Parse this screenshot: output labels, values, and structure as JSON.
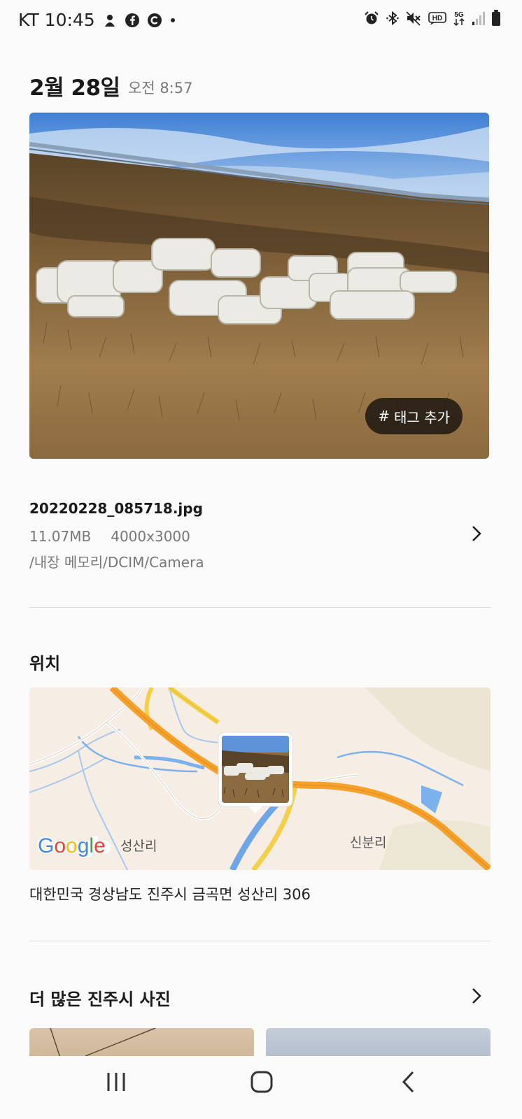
{
  "status_bar": {
    "carrier_time": "KT 10:45",
    "notification_icons": [
      "game-launcher-icon",
      "facebook-icon",
      "c-app-icon",
      "dot-icon"
    ],
    "system_icons": [
      "alarm-icon",
      "bluetooth-icon",
      "mute-icon",
      "hd-voice-icon",
      "5g-icon",
      "signal-icon",
      "battery-icon"
    ],
    "hd_label": "HD",
    "net_label": "5G"
  },
  "header": {
    "date": "2월 28일",
    "time": "오전 8:57"
  },
  "photo": {
    "tag_button_label": "태그 추가",
    "tag_symbol": "#"
  },
  "file_info": {
    "name": "20220228_085718.jpg",
    "size": "11.07MB",
    "resolution": "4000x3000",
    "path": "/내장 메모리/DCIM/Camera"
  },
  "location": {
    "title": "위치",
    "map_labels": {
      "village_left": "성산리",
      "village_right": "신분리",
      "brand": "Google"
    },
    "address": "대한민국 경상남도 진주시 금곡면 성산리 306"
  },
  "more_photos": {
    "title": "더 많은 진주시 사진"
  },
  "nav_bar": {
    "buttons": [
      "recent-apps-icon",
      "home-icon",
      "back-icon"
    ]
  }
}
